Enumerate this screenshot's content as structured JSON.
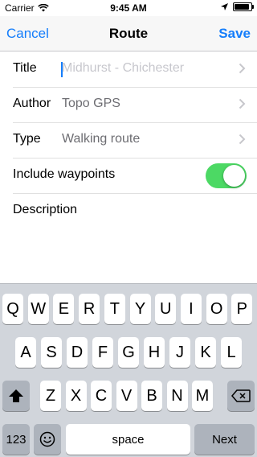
{
  "status_bar": {
    "carrier": "Carrier",
    "time": "9:45 AM",
    "wifi_icon": "wifi-icon",
    "location_icon": "location-arrow-icon",
    "battery_level": 1.0
  },
  "nav": {
    "cancel_label": "Cancel",
    "title": "Route",
    "save_label": "Save"
  },
  "form": {
    "title": {
      "label": "Title",
      "placeholder": "Midhurst - Chichester"
    },
    "author": {
      "label": "Author",
      "value": "Topo GPS"
    },
    "type": {
      "label": "Type",
      "value": "Walking route"
    },
    "waypoints": {
      "label": "Include waypoints",
      "on": true
    },
    "description": {
      "label": "Description"
    }
  },
  "colors": {
    "accent": "#157efb",
    "toggle_on": "#4cd964"
  },
  "keyboard": {
    "row1": [
      "Q",
      "W",
      "E",
      "R",
      "T",
      "Y",
      "U",
      "I",
      "O",
      "P"
    ],
    "row2": [
      "A",
      "S",
      "D",
      "F",
      "G",
      "H",
      "J",
      "K",
      "L"
    ],
    "row3": [
      "Z",
      "X",
      "C",
      "V",
      "B",
      "N",
      "M"
    ],
    "shift_icon": "shift-arrow-icon",
    "backspace_icon": "backspace-icon",
    "emoji_icon": "emoji-icon",
    "numbers_label": "123",
    "space_label": "space",
    "next_label": "Next"
  }
}
